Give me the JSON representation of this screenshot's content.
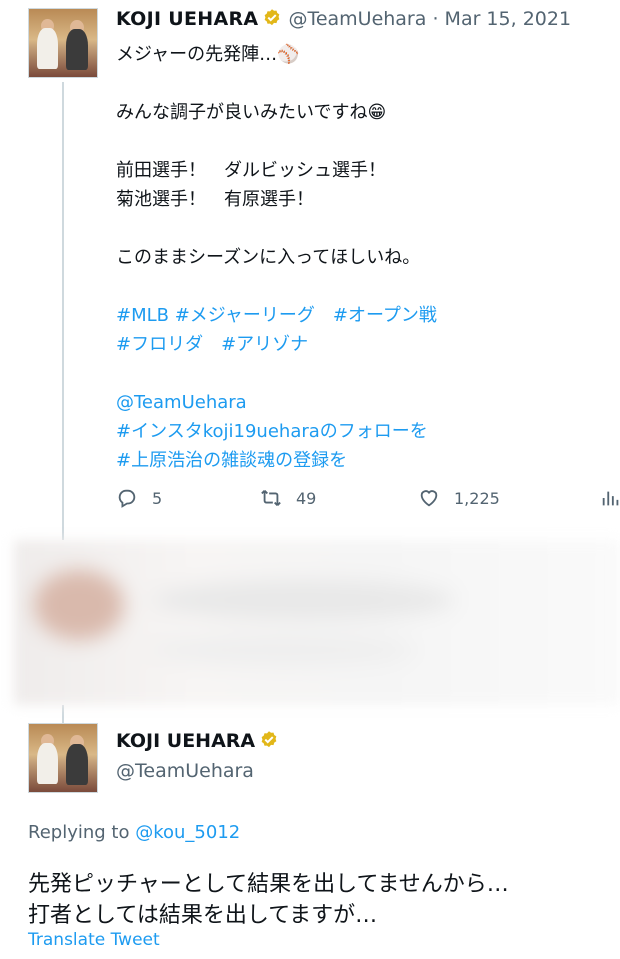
{
  "tweet1": {
    "name": "KOJI UEHARA",
    "handle": "@TeamUehara",
    "separator": "·",
    "date": "Mar 15, 2021",
    "lines": [
      {
        "text": "メジャーの先発陣…⚾",
        "tag": false
      },
      {
        "text": "",
        "tag": false
      },
      {
        "text": "みんな調子が良いみたいですね😁",
        "tag": false
      },
      {
        "text": "",
        "tag": false
      },
      {
        "text": "前田選手！　ダルビッシュ選手！",
        "tag": false
      },
      {
        "text": "菊池選手！　有原選手！",
        "tag": false
      },
      {
        "text": "",
        "tag": false
      },
      {
        "text": "このままシーズンに入ってほしいね。",
        "tag": false
      },
      {
        "text": "",
        "tag": false
      },
      {
        "text": "#MLB  #メジャーリーグ　#オープン戦",
        "tag": true
      },
      {
        "text": "#フロリダ　#アリゾナ",
        "tag": true
      },
      {
        "text": "",
        "tag": false
      },
      {
        "text": "@TeamUehara",
        "tag": true
      },
      {
        "text": "#インスタkoji19ueharaのフォローを",
        "tag": true
      },
      {
        "text": "#上原浩治の雑談魂の登録を",
        "tag": true
      }
    ],
    "actions": {
      "reply_count": "5",
      "retweet_count": "49",
      "like_count": "1,225"
    }
  },
  "tweet2": {
    "name": "KOJI UEHARA",
    "handle": "@TeamUehara",
    "replying_prefix": "Replying to",
    "replying_to": "@kou_5012",
    "text_lines": [
      "先発ピッチャーとして結果を出してませんから…",
      "打者としては結果を出してますが…"
    ],
    "translate_label": "Translate Tweet"
  },
  "colors": {
    "accent": "#1d9bf0",
    "secondary_text": "#536471",
    "verified_gold": "#e2b719"
  },
  "icons": {
    "verified": "verified-badge-icon",
    "reply": "reply-icon",
    "retweet": "retweet-icon",
    "like": "heart-icon",
    "analytics": "analytics-icon"
  }
}
